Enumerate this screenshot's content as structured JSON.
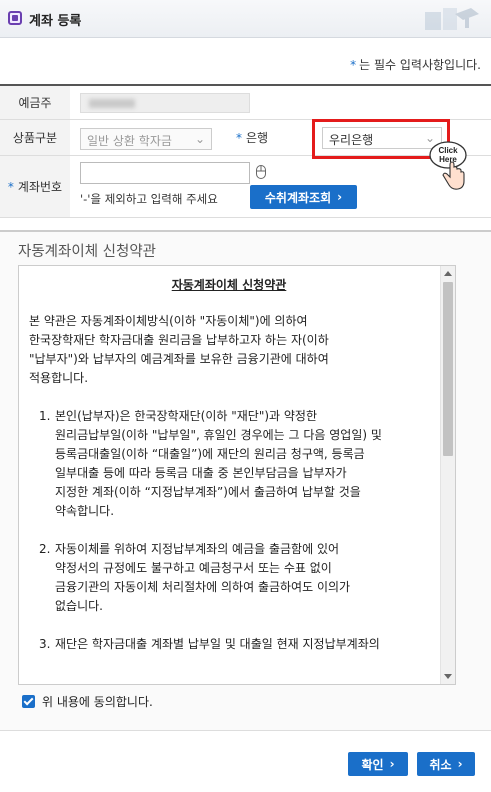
{
  "window": {
    "title": "계좌 등록"
  },
  "required_note": {
    "star": "*",
    "text": "는 필수 입력사항입니다."
  },
  "form": {
    "depositor": {
      "label": "예금주"
    },
    "product_type": {
      "label": "상품구분",
      "value": "일반 상환 학자금"
    },
    "bank": {
      "star": "*",
      "label": "은행",
      "value": "우리은행"
    },
    "account_number": {
      "star": "*",
      "label": "계좌번호",
      "value": "",
      "hint": "'-'을 제외하고 입력해 주세요",
      "inquiry_button": "수취계좌조회"
    }
  },
  "click_here": {
    "line1": "Click",
    "line2": "Here"
  },
  "terms": {
    "heading": "자동계좌이체 신청약관",
    "title": "자동계좌이체 신청약관",
    "intro": [
      "본 약관은 자동계좌이체방식(이하 \"자동이체\")에 의하여",
      "한국장학재단 학자금대출 원리금을 납부하고자 하는 자(이하",
      "\"납부자\")와 납부자의 예금계좌를 보유한 금융기관에 대하여",
      "적용합니다."
    ],
    "items": [
      {
        "num": "1.",
        "lines": [
          "본인(납부자)은 한국장학재단(이하 \"재단\")과 약정한",
          "원리금납부일(이하 \"납부일\", 휴일인 경우에는 그 다음 영업일) 및",
          "등록금대출일(이하 “대출일”)에 재단의 원리금 청구액, 등록금",
          "일부대출 등에 따라 등록금 대출 중 본인부담금을 납부자가",
          "지정한 계좌(이하 “지정납부계좌”)에서 출금하여 납부할 것을",
          "약속합니다."
        ]
      },
      {
        "num": "2.",
        "lines": [
          "자동이체를 위하여 지정납부계좌의 예금을 출금함에 있어",
          "약정서의 규정에도 불구하고 예금청구서 또는 수표 없이",
          "금융기관의 자동이체 처리절차에 의하여 출금하여도 이의가",
          "없습니다."
        ]
      },
      {
        "num": "3.",
        "lines": [
          "재단은 학자금대출 계좌별 납부일 및 대출일 현재 지정납부계좌의"
        ]
      }
    ]
  },
  "agree": {
    "label": "위 내용에 동의합니다.",
    "checked": true
  },
  "buttons": {
    "ok": "확인",
    "cancel": "취소"
  },
  "colors": {
    "accent": "#1a6fc9",
    "highlight": "#e41b1b",
    "required_star": "#1a6fc9"
  }
}
